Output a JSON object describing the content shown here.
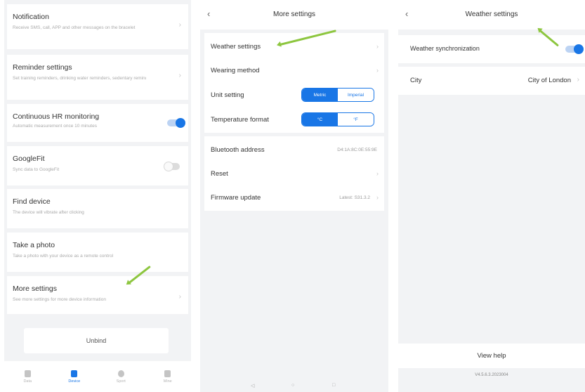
{
  "screen1": {
    "cards": [
      {
        "title": "Notification",
        "subtitle": "Receive SMS, call, APP and other messages on the bracelet",
        "control": "chevron"
      },
      {
        "title": "Reminder settings",
        "subtitle": "Set training reminders, drinking water reminders, sedentary reminders, etc.",
        "control": "chevron"
      },
      {
        "title": "Continuous HR monitoring",
        "subtitle": "Automatic measurement once 10 minutes",
        "control": "toggle",
        "toggle_on": true
      },
      {
        "title": "GoogleFit",
        "subtitle": "Sync data to GoogleFit",
        "control": "toggle",
        "toggle_on": false
      },
      {
        "title": "Find device",
        "subtitle": "The device will vibrate after clicking",
        "control": "none"
      },
      {
        "title": "Take a photo",
        "subtitle": "Take a photo with your device as a remote control",
        "control": "none"
      },
      {
        "title": "More settings",
        "subtitle": "See more settings for more device information",
        "control": "chevron"
      }
    ],
    "unbind_label": "Unbind",
    "tabs": [
      {
        "label": "Data",
        "icon": "home-icon",
        "active": false
      },
      {
        "label": "Device",
        "icon": "watch-icon",
        "active": true
      },
      {
        "label": "Sport",
        "icon": "sport-icon",
        "active": false
      },
      {
        "label": "Mine",
        "icon": "person-icon",
        "active": false
      }
    ],
    "chevron": "›"
  },
  "screen2": {
    "back": "‹",
    "title": "More settings",
    "rows_group1": [
      {
        "label": "Weather settings",
        "type": "chevron"
      },
      {
        "label": "Wearing method",
        "type": "chevron"
      },
      {
        "label": "Unit setting",
        "type": "segment",
        "options": [
          "Metric",
          "Imperial"
        ],
        "selected": 0
      },
      {
        "label": "Temperature format",
        "type": "segment",
        "options": [
          "°C",
          "°F"
        ],
        "selected": 0
      }
    ],
    "rows_group2": [
      {
        "label": "Bluetooth address",
        "type": "value",
        "value": "D4:1A:8C:0E:55:9E"
      },
      {
        "label": "Reset",
        "type": "chevron"
      },
      {
        "label": "Firmware update",
        "type": "value_chevron",
        "value": "Latest: S31.3.2"
      }
    ],
    "chevron": "›",
    "nav": [
      "◁",
      "○",
      "□"
    ]
  },
  "screen3": {
    "back": "‹",
    "title": "Weather settings",
    "sync_label": "Weather synchronization",
    "sync_on": true,
    "city_label": "City",
    "city_value": "City of London",
    "chevron": "›",
    "view_help": "View help",
    "version": "V4.5.6.3.2023004"
  },
  "colors": {
    "accent": "#1976e6",
    "annotation_arrow": "#8dc63f",
    "background": "#f2f3f5"
  }
}
